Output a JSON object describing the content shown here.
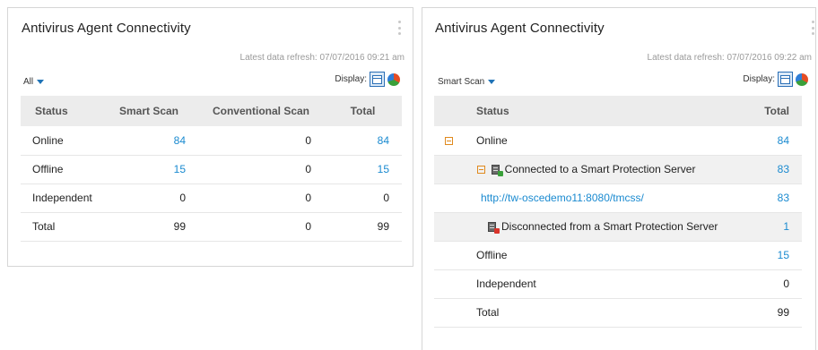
{
  "left_widget": {
    "title": "Antivirus Agent Connectivity",
    "refresh": "Latest data refresh: 07/07/2016 09:21 am",
    "filter": "All",
    "display_label": "Display:",
    "columns": [
      "Status",
      "Smart Scan",
      "Conventional Scan",
      "Total"
    ],
    "rows": [
      {
        "status": "Online",
        "smart": "84",
        "conventional": "0",
        "total": "84"
      },
      {
        "status": "Offline",
        "smart": "15",
        "conventional": "0",
        "total": "15"
      },
      {
        "status": "Independent",
        "smart": "0",
        "conventional": "0",
        "total": "0"
      },
      {
        "status": "Total",
        "smart": "99",
        "conventional": "0",
        "total": "99"
      }
    ]
  },
  "right_widget": {
    "title": "Antivirus Agent Connectivity",
    "refresh": "Latest data refresh: 07/07/2016 09:22 am",
    "filter": "Smart Scan",
    "display_label": "Display:",
    "columns": [
      "Status",
      "Total"
    ],
    "rows": {
      "online": {
        "label": "Online",
        "total": "84"
      },
      "connected": {
        "label": "Connected to a Smart Protection Server",
        "total": "83"
      },
      "server_url": {
        "label": "http://tw-oscedemo11:8080/tmcss/",
        "total": "83"
      },
      "disconnected": {
        "label": "Disconnected from a Smart Protection Server",
        "total": "1"
      },
      "offline": {
        "label": "Offline",
        "total": "15"
      },
      "independent": {
        "label": "Independent",
        "total": "0"
      },
      "total": {
        "label": "Total",
        "total": "99"
      }
    }
  },
  "colors": {
    "link": "#1a8ad0",
    "header_bg": "#ececec",
    "expand_icon": "#e08a1e",
    "dropdown_caret": "#1f73b7"
  },
  "icons": [
    "more-vertical-icon",
    "chevron-down-icon",
    "table-view-icon",
    "pie-chart-icon",
    "collapse-icon",
    "server-connected-icon",
    "server-disconnected-icon"
  ]
}
